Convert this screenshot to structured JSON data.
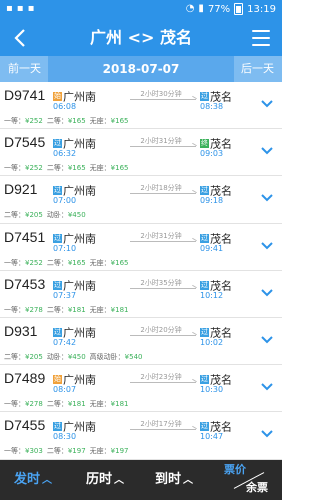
{
  "status_bar": {
    "battery": "77%",
    "time": "13:19"
  },
  "header": {
    "title": "广州 <> 茂名"
  },
  "date_bar": {
    "prev_label": "前一天",
    "date": "2018-07-07",
    "next_label": "后一天"
  },
  "trains": [
    {
      "code": "D9741",
      "from_tag": "始",
      "from": "广州南",
      "dep": "06:08",
      "duration": "2小时30分钟",
      "to_tag": "过",
      "to": "茂名",
      "arr": "08:38",
      "prices": [
        {
          "label": "一等：",
          "value": "¥252"
        },
        {
          "label": "二等：",
          "value": "¥165"
        },
        {
          "label": "无座：",
          "value": "¥165"
        }
      ]
    },
    {
      "code": "D7545",
      "from_tag": "过",
      "from": "广州南",
      "dep": "06:32",
      "duration": "2小时31分钟",
      "to_tag": "终",
      "to": "茂名",
      "arr": "09:03",
      "prices": [
        {
          "label": "一等：",
          "value": "¥252"
        },
        {
          "label": "二等：",
          "value": "¥165"
        },
        {
          "label": "无座：",
          "value": "¥165"
        }
      ]
    },
    {
      "code": "D921",
      "from_tag": "过",
      "from": "广州南",
      "dep": "07:00",
      "duration": "2小时18分钟",
      "to_tag": "过",
      "to": "茂名",
      "arr": "09:18",
      "prices": [
        {
          "label": "二等：",
          "value": "¥205"
        },
        {
          "label": "动卧：",
          "value": "¥450"
        }
      ]
    },
    {
      "code": "D7451",
      "from_tag": "过",
      "from": "广州南",
      "dep": "07:10",
      "duration": "2小时31分钟",
      "to_tag": "过",
      "to": "茂名",
      "arr": "09:41",
      "prices": [
        {
          "label": "一等：",
          "value": "¥252"
        },
        {
          "label": "二等：",
          "value": "¥165"
        },
        {
          "label": "无座：",
          "value": "¥165"
        }
      ]
    },
    {
      "code": "D7453",
      "from_tag": "过",
      "from": "广州南",
      "dep": "07:37",
      "duration": "2小时35分钟",
      "to_tag": "过",
      "to": "茂名",
      "arr": "10:12",
      "prices": [
        {
          "label": "一等：",
          "value": "¥278"
        },
        {
          "label": "二等：",
          "value": "¥181"
        },
        {
          "label": "无座：",
          "value": "¥181"
        }
      ]
    },
    {
      "code": "D931",
      "from_tag": "过",
      "from": "广州南",
      "dep": "07:42",
      "duration": "2小时20分钟",
      "to_tag": "过",
      "to": "茂名",
      "arr": "10:02",
      "prices": [
        {
          "label": "二等：",
          "value": "¥205"
        },
        {
          "label": "动卧：",
          "value": "¥450"
        },
        {
          "label": "高级动卧：",
          "value": "¥540"
        }
      ]
    },
    {
      "code": "D7489",
      "from_tag": "始",
      "from": "广州南",
      "dep": "08:07",
      "duration": "2小时23分钟",
      "to_tag": "过",
      "to": "茂名",
      "arr": "10:30",
      "prices": [
        {
          "label": "一等：",
          "value": "¥278"
        },
        {
          "label": "二等：",
          "value": "¥181"
        },
        {
          "label": "无座：",
          "value": "¥181"
        }
      ]
    },
    {
      "code": "D7455",
      "from_tag": "过",
      "from": "广州南",
      "dep": "08:30",
      "duration": "2小时17分钟",
      "to_tag": "过",
      "to": "茂名",
      "arr": "10:47",
      "prices": [
        {
          "label": "一等：",
          "value": "¥303"
        },
        {
          "label": "二等：",
          "value": "¥197"
        },
        {
          "label": "无座：",
          "value": "¥197"
        }
      ]
    }
  ],
  "footer": {
    "tab1": "发时",
    "tab2": "历时",
    "tab3": "到时",
    "tab4_top": "票价",
    "tab4_bottom": "余票"
  },
  "icons": {
    "back": "back-arrow-icon",
    "menu": "hamburger-menu-icon",
    "expand": "chevron-down-icon"
  },
  "colors": {
    "primary": "#2d93e8",
    "date_bar": "#7ebcf1",
    "price_green": "#3bb15a",
    "tag_start": "#f0a13a",
    "tag_pass": "#3aa0e2",
    "tag_end": "#3bb15a",
    "footer_bg": "#2b2b2b"
  }
}
